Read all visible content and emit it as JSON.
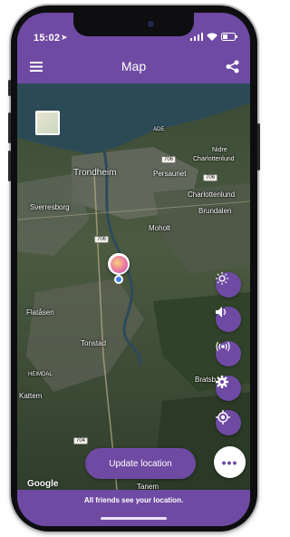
{
  "status_bar": {
    "time": "15:02",
    "icons": [
      "location-arrow-icon",
      "signal-icon",
      "wifi-icon",
      "battery-icon"
    ]
  },
  "app_bar": {
    "title": "Map",
    "menu_icon": "hamburger-menu-icon",
    "share_icon": "share-icon"
  },
  "map": {
    "labels": [
      "Trondheim",
      "Persaunet",
      "Sverresborg",
      "Charlottenlund",
      "Brundalen",
      "Moholt",
      "Flatåsen",
      "Tonstad",
      "Kattem",
      "HEIMDAL",
      "Tanem",
      "Bratsb",
      "Nidre",
      "Charlottenlund",
      "ADE"
    ],
    "road_badges": [
      "706",
      "706",
      "706",
      "704"
    ],
    "attribution": "Google"
  },
  "controls": [
    {
      "name": "brightness-icon"
    },
    {
      "name": "volume-icon"
    },
    {
      "name": "broadcast-icon"
    },
    {
      "name": "settings-icon"
    },
    {
      "name": "locate-icon"
    }
  ],
  "more_button": {
    "label": "•••"
  },
  "update_button": {
    "label": "Update location"
  },
  "footer": {
    "text": "All friends see your location."
  },
  "colors": {
    "primary": "#6f4aa3",
    "white": "#ffffff",
    "user_dot": "#3a7bef"
  }
}
